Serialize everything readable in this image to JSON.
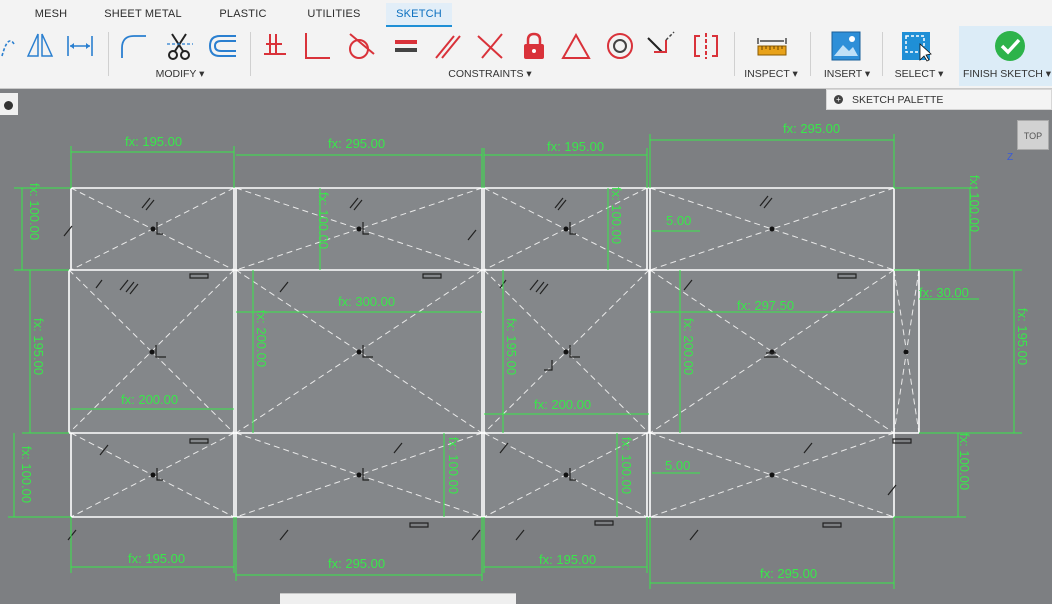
{
  "tabs": [
    "MESH",
    "SHEET METAL",
    "PLASTIC",
    "UTILITIES",
    "SKETCH"
  ],
  "active_tab": "SKETCH",
  "groups": {
    "modify": "MODIFY ▾",
    "constraints": "CONSTRAINTS ▾",
    "inspect": "INSPECT ▾",
    "insert": "INSERT ▾",
    "select": "SELECT ▾",
    "finish": "FINISH SKETCH ▾"
  },
  "palette": {
    "label": "SKETCH PALETTE"
  },
  "viewcube": {
    "label": "TOP"
  },
  "axis_label": "Z",
  "colors": {
    "accent": "#1e8fd6",
    "dimension": "#38e84a",
    "sketch_line": "#ffffff",
    "constraint_red": "#d9323a",
    "finish_green": "#2db34a"
  },
  "dimensions": [
    "fx: 195.00",
    "fx: 295.00",
    "fx: 195.00",
    "fx: 295.00",
    "fx: 100.00",
    "fx: 100.00",
    "fx: 100.00",
    "fx: 100.00",
    "5.00",
    "fx: 300.00",
    "fx: 297.50",
    "fx: 30.00",
    "fx: 195.00",
    "fx: 200.00",
    "fx: 195.00",
    "fx: 200.00",
    "fx: 195.00",
    "fx: 200.00",
    "fx: 200.00",
    "fx: 100.00",
    "fx: 100.00",
    "fx: 100.00",
    "5.00",
    "fx: 100.00",
    "fx: 195.00",
    "fx: 295.00",
    "fx: 195.00",
    "fx: 295.00"
  ]
}
